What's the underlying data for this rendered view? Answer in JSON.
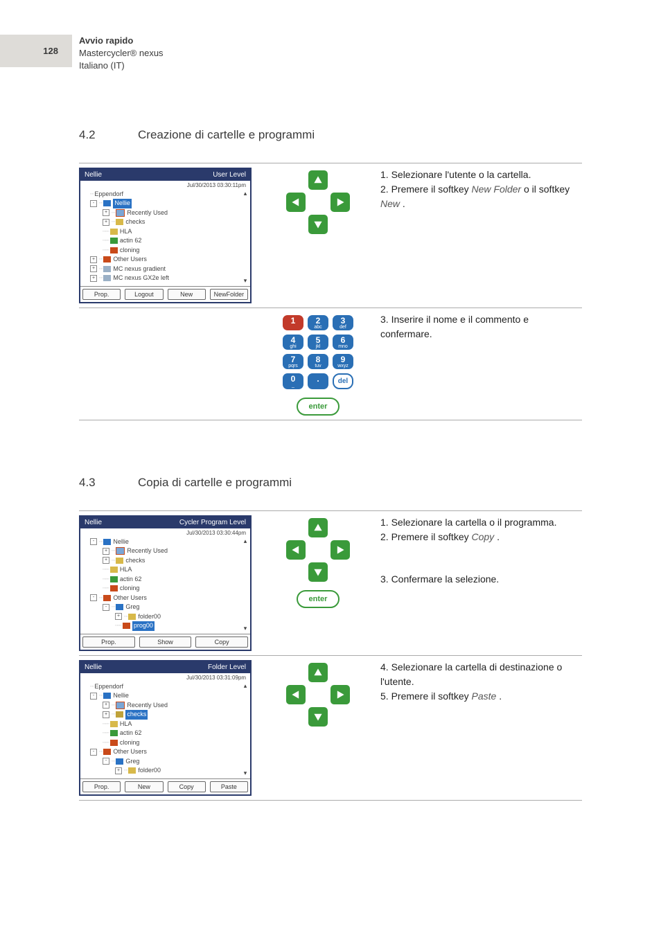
{
  "pageNumber": "128",
  "header": {
    "title": "Avvio rapido",
    "product": "Mastercycler® nexus",
    "lang": "Italiano (IT)"
  },
  "section42": {
    "num": "4.2",
    "title": "Creazione di cartelle e programmi"
  },
  "section43": {
    "num": "4.3",
    "title": "Copia di cartelle e programmi"
  },
  "screen1": {
    "title": "Nellie",
    "level": "User Level",
    "ts": "Jul/30/2013 03:30:11pm",
    "root": "Eppendorf",
    "nodes": {
      "nellie": "Nellie",
      "recent": "Recently Used",
      "checks": "checks",
      "hla": "HLA",
      "actin": "actin 62",
      "cloning": "cloning",
      "other": "Other Users",
      "dev1": "MC nexus gradient",
      "dev2": "MC nexus GX2e left"
    },
    "btns": {
      "b1": "Prop.",
      "b2": "Logout",
      "b3": "New",
      "b4": "NewFolder"
    }
  },
  "steps42a": {
    "s1": "1. Selezionare l'utente o la cartella.",
    "s2": "2. Premere il softkey ",
    "s2k1": "New Folder",
    "s2mid": " o il softkey ",
    "s2k2": "New",
    "s2end": " ."
  },
  "steps42b": {
    "s3": "3. Inserire il nome e il commento e confermare."
  },
  "keypad": {
    "k1": "1",
    "k2": "2",
    "k2s": "abc",
    "k3": "3",
    "k3s": "def",
    "k4": "4",
    "k4s": "ghi",
    "k5": "5",
    "k5s": "jkl",
    "k6": "6",
    "k6s": "mno",
    "k7": "7",
    "k7s": "pqrs",
    "k8": "8",
    "k8s": "tuv",
    "k9": "9",
    "k9s": "wxyz",
    "k0": "0",
    "k0s": "_",
    "kdot": ".",
    "kdel": "del",
    "enter": "enter"
  },
  "screen2": {
    "title": "Nellie",
    "level": "Cycler Program Level",
    "ts": "Jul/30/2013 03:30:44pm",
    "nodes": {
      "nellie": "Nellie",
      "recent": "Recently Used",
      "checks": "checks",
      "hla": "HLA",
      "actin": "actin 62",
      "cloning": "cloning",
      "other": "Other Users",
      "greg": "Greg",
      "folder00": "folder00",
      "prog00": "prog00"
    },
    "btns": {
      "b1": "Prop.",
      "b2": "Show",
      "b3": "Copy"
    }
  },
  "steps43a": {
    "s1": "1. Selezionare la cartella o il programma.",
    "s2": "2. Premere il softkey ",
    "s2k": "Copy",
    "s2end": " .",
    "s3": "3. Confermare la selezione."
  },
  "screen3": {
    "title": "Nellie",
    "level": "Folder Level",
    "ts": "Jul/30/2013 03:31:09pm",
    "root": "Eppendorf",
    "nodes": {
      "nellie": "Nellie",
      "recent": "Recently Used",
      "checks": "checks",
      "hla": "HLA",
      "actin": "actin 62",
      "cloning": "cloning",
      "other": "Other Users",
      "greg": "Greg",
      "folder00": "folder00"
    },
    "btns": {
      "b1": "Prop.",
      "b2": "New",
      "b3": "Copy",
      "b4": "Paste"
    }
  },
  "steps43b": {
    "s4": "4. Selezionare la cartella di destinazione o l'utente.",
    "s5": "5. Premere il softkey ",
    "s5k": "Paste",
    "s5end": " ."
  },
  "enterLabel": "enter"
}
